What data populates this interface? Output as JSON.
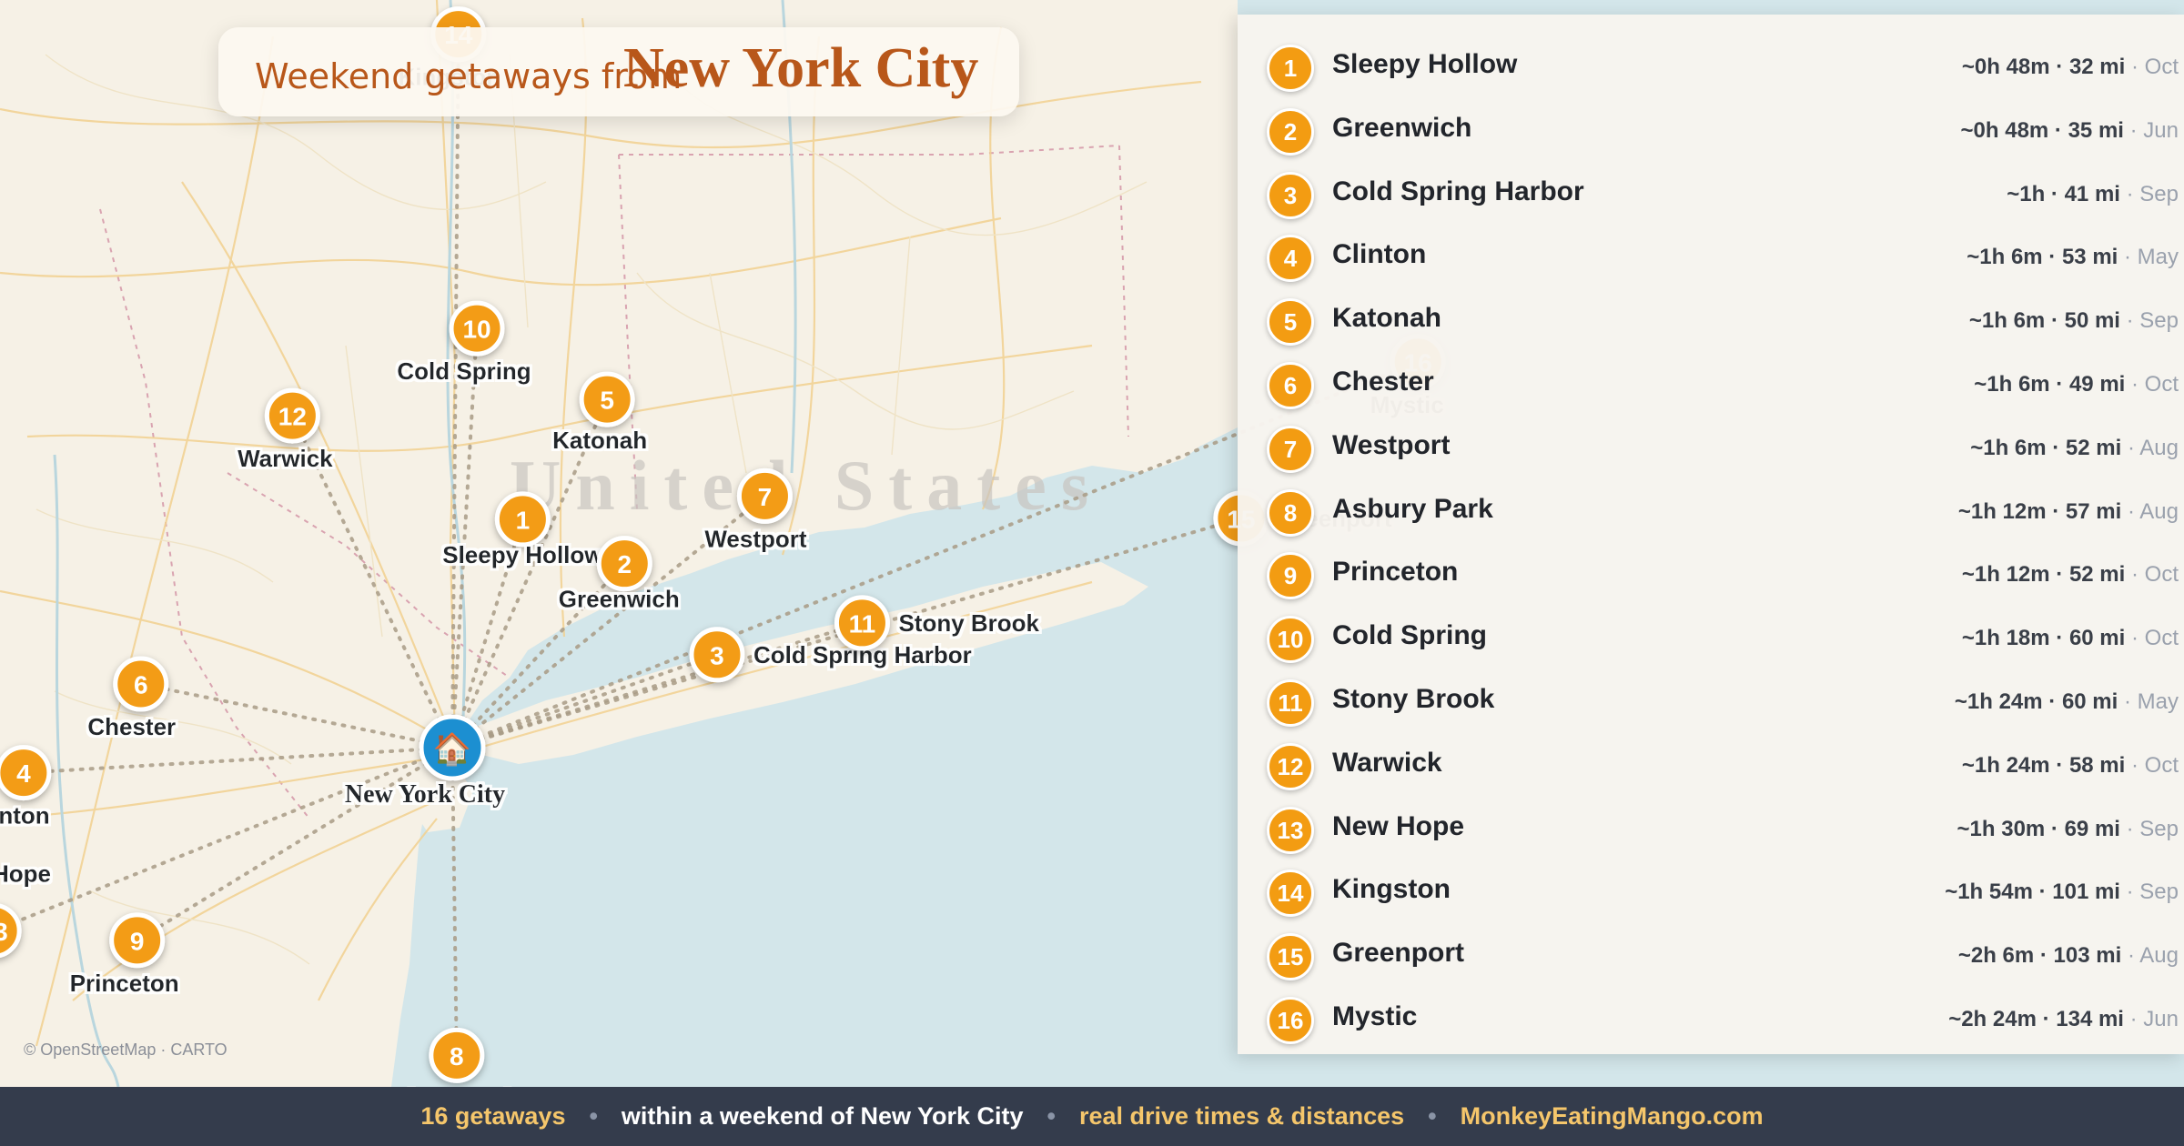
{
  "title": {
    "prefix": "Weekend getaways from",
    "city": "New York City"
  },
  "home": {
    "label": "New York City",
    "icon": "house-icon"
  },
  "map_labels": {
    "country_watermark": "United States"
  },
  "attribution": "© OpenStreetMap · CARTO",
  "colors": {
    "marker": "#f39c12",
    "home_marker": "#1f8fd1",
    "title": "#b8571a",
    "footer_bg": "#343c4c",
    "footer_accent": "#f5c66b",
    "water": "#d3e6ea",
    "land": "#f6f1e6"
  },
  "places": [
    {
      "num": "1",
      "name": "Sleepy Hollow",
      "stat": "~0h 48m · 32 mi",
      "month": "Oct",
      "lat": 41.086,
      "lon": -73.86
    },
    {
      "num": "2",
      "name": "Greenwich",
      "stat": "~0h 48m · 35 mi",
      "month": "Jun",
      "lat": 41.026,
      "lon": -73.63
    },
    {
      "num": "3",
      "name": "Cold Spring Harbor",
      "stat": "~1h · 41 mi",
      "month": "Sep",
      "lat": 40.871,
      "lon": -73.457
    },
    {
      "num": "4",
      "name": "Clinton",
      "stat": "~1h 6m · 53 mi",
      "month": "May",
      "lat": 40.636,
      "lon": -74.91
    },
    {
      "num": "5",
      "name": "Katonah",
      "stat": "~1h 6m · 50 mi",
      "month": "Sep",
      "lat": 41.259,
      "lon": -73.685
    },
    {
      "num": "6",
      "name": "Chester",
      "stat": "~1h 6m · 49 mi",
      "month": "Oct",
      "lat": 40.784,
      "lon": -74.697
    },
    {
      "num": "7",
      "name": "Westport",
      "stat": "~1h 6m · 52 mi",
      "month": "Aug",
      "lat": 41.141,
      "lon": -73.358
    },
    {
      "num": "8",
      "name": "Asbury Park",
      "stat": "~1h 12m · 57 mi",
      "month": "Aug",
      "lat": 40.22,
      "lon": -74.012
    },
    {
      "num": "9",
      "name": "Princeton",
      "stat": "~1h 12m · 52 mi",
      "month": "Oct",
      "lat": 40.357,
      "lon": -74.667
    },
    {
      "num": "10",
      "name": "Cold Spring",
      "stat": "~1h 18m · 60 mi",
      "month": "Oct",
      "lat": 41.42,
      "lon": -73.955
    },
    {
      "num": "11",
      "name": "Stony Brook",
      "stat": "~1h 24m · 60 mi",
      "month": "May",
      "lat": 40.925,
      "lon": -73.141
    },
    {
      "num": "12",
      "name": "Warwick",
      "stat": "~1h 24m · 58 mi",
      "month": "Oct",
      "lat": 41.256,
      "lon": -74.36
    },
    {
      "num": "13",
      "name": "New Hope",
      "stat": "~1h 30m · 69 mi",
      "month": "Sep",
      "lat": 40.364,
      "lon": -74.951
    },
    {
      "num": "14",
      "name": "Kingston",
      "stat": "~1h 54m · 101 mi",
      "month": "Sep",
      "lat": 41.927,
      "lon": -73.997
    },
    {
      "num": "15",
      "name": "Greenport",
      "stat": "~2h 6m · 103 mi",
      "month": "Aug",
      "lat": 41.103,
      "lon": -72.359
    },
    {
      "num": "16",
      "name": "Mystic",
      "stat": "~2h 24m · 134 mi",
      "month": "Jun",
      "lat": 41.354,
      "lon": -71.966
    }
  ],
  "footer": {
    "count": "16 getaways",
    "scope": "within a weekend of New York City",
    "method": "real drive times & distances",
    "site": "MonkeyEatingMango.com"
  }
}
